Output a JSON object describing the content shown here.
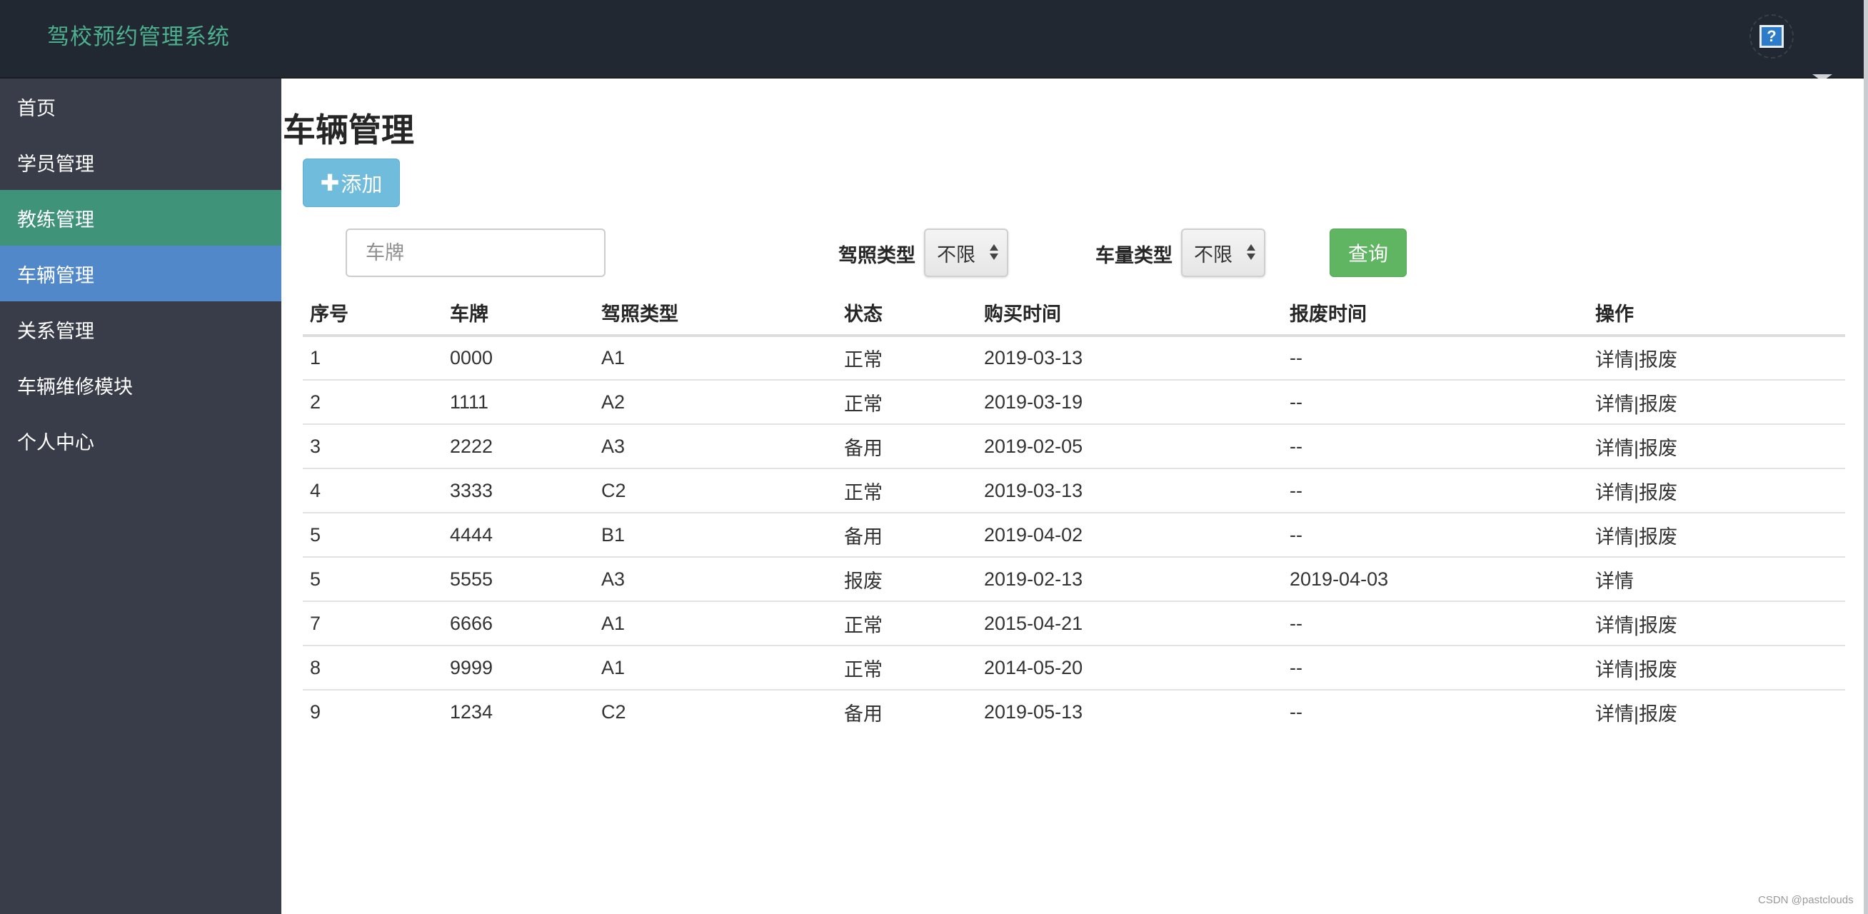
{
  "header": {
    "brand": "驾校预约管理系统",
    "help_icon": "?"
  },
  "sidebar": {
    "items": [
      {
        "label": "首页"
      },
      {
        "label": "学员管理"
      },
      {
        "label": "教练管理"
      },
      {
        "label": "车辆管理"
      },
      {
        "label": "关系管理"
      },
      {
        "label": "车辆维修模块"
      },
      {
        "label": "个人中心"
      }
    ]
  },
  "main": {
    "title": "车辆管理",
    "add_button": {
      "icon": "plus-icon",
      "label": "添加"
    },
    "filters": {
      "plate_placeholder": "车牌",
      "license_type_label": "驾照类型",
      "license_type_value": "不限",
      "vehicle_type_label": "车量类型",
      "vehicle_type_value": "不限",
      "query_label": "查询"
    },
    "table": {
      "columns": [
        "序号",
        "车牌",
        "驾照类型",
        "状态",
        "购买时间",
        "报废时间",
        "操作"
      ],
      "rows": [
        {
          "no": "1",
          "plate": "0000",
          "license": "A1",
          "status": "正常",
          "bought": "2019-03-13",
          "scrapped": "--",
          "ops": [
            "详情",
            "报废"
          ]
        },
        {
          "no": "2",
          "plate": "1111",
          "license": "A2",
          "status": "正常",
          "bought": "2019-03-19",
          "scrapped": "--",
          "ops": [
            "详情",
            "报废"
          ]
        },
        {
          "no": "3",
          "plate": "2222",
          "license": "A3",
          "status": "备用",
          "bought": "2019-02-05",
          "scrapped": "--",
          "ops": [
            "详情",
            "报废"
          ]
        },
        {
          "no": "4",
          "plate": "3333",
          "license": "C2",
          "status": "正常",
          "bought": "2019-03-13",
          "scrapped": "--",
          "ops": [
            "详情",
            "报废"
          ]
        },
        {
          "no": "5",
          "plate": "4444",
          "license": "B1",
          "status": "备用",
          "bought": "2019-04-02",
          "scrapped": "--",
          "ops": [
            "详情",
            "报废"
          ]
        },
        {
          "no": "5",
          "plate": "5555",
          "license": "A3",
          "status": "报废",
          "bought": "2019-02-13",
          "scrapped": "2019-04-03",
          "ops": [
            "详情"
          ]
        },
        {
          "no": "7",
          "plate": "6666",
          "license": "A1",
          "status": "正常",
          "bought": "2015-04-21",
          "scrapped": "--",
          "ops": [
            "详情",
            "报废"
          ]
        },
        {
          "no": "8",
          "plate": "9999",
          "license": "A1",
          "status": "正常",
          "bought": "2014-05-20",
          "scrapped": "--",
          "ops": [
            "详情",
            "报废"
          ]
        },
        {
          "no": "9",
          "plate": "1234",
          "license": "C2",
          "status": "备用",
          "bought": "2019-05-13",
          "scrapped": "--",
          "ops": [
            "详情",
            "报废"
          ]
        }
      ],
      "op_separator": "|"
    }
  },
  "watermark": "CSDN @pastclouds",
  "colors": {
    "topbar": "#222831",
    "brand": "#4caf8f",
    "sidebar": "#393d4a",
    "sidebar_teal": "#3f9379",
    "sidebar_active": "#5188c9",
    "add_button": "#6fbcdc",
    "query_button": "#5fb561"
  }
}
